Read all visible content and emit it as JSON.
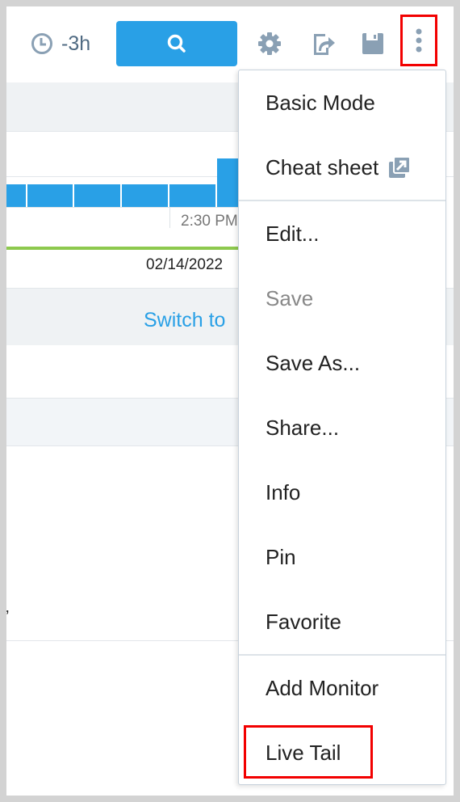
{
  "toolbar": {
    "time_range": "-3h",
    "icons": [
      "clock-icon",
      "search-icon",
      "gear-icon",
      "share-icon",
      "save-icon",
      "more-vertical-icon"
    ]
  },
  "chart": {
    "tick_label": "2:30 PM",
    "date_label": "02/14/2022"
  },
  "switch_link": "Switch to",
  "menu": {
    "items": [
      {
        "label": "Basic Mode"
      },
      {
        "label": "Cheat sheet",
        "icon": "external-link-icon"
      },
      {
        "label": "Edit..."
      },
      {
        "label": "Save",
        "disabled": true
      },
      {
        "label": "Save As..."
      },
      {
        "label": "Share..."
      },
      {
        "label": "Info"
      },
      {
        "label": "Pin"
      },
      {
        "label": "Favorite"
      },
      {
        "label": "Add Monitor"
      },
      {
        "label": "Live Tail",
        "highlighted": true
      }
    ]
  },
  "colors": {
    "accent": "#29a0e6",
    "icon": "#8aa0b4",
    "highlight": "#f20000",
    "green_line": "#8dc94e"
  }
}
